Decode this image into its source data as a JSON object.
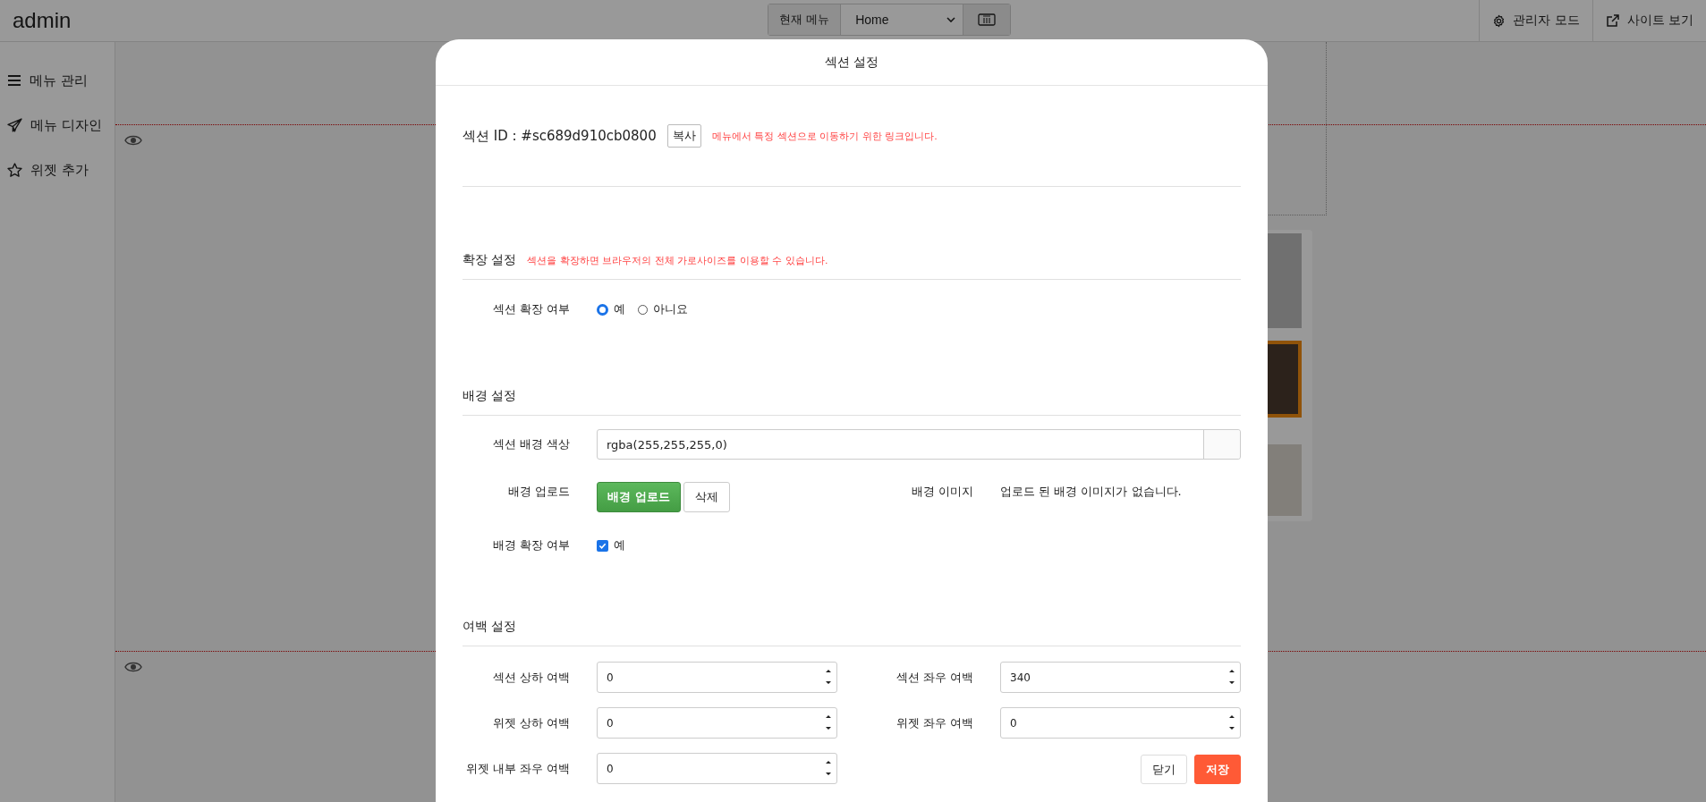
{
  "app": {
    "logo": "admin"
  },
  "toolbar": {
    "current_menu_label": "현재 메뉴",
    "current_menu_value": "Home"
  },
  "top_actions": [
    {
      "label": "관리자 모드",
      "kind": "gear"
    },
    {
      "label": "사이트 보기",
      "kind": "external"
    }
  ],
  "sidebar": {
    "items": [
      {
        "label": "메뉴 관리",
        "kind": "menu"
      },
      {
        "label": "메뉴 디자인",
        "kind": "plane"
      },
      {
        "label": "위젯 추가",
        "kind": "star"
      }
    ]
  },
  "modal": {
    "title": "섹션 설정",
    "section_id": {
      "label": "섹션 ID : #sc689d910cb0800",
      "copy_button": "복사",
      "note": "메뉴에서 특정 섹션으로 이동하기 위한 링크입니다."
    },
    "expand": {
      "heading": "확장 설정",
      "note": "섹션을 확장하면 브라우저의 전체 가로사이즈를 이용할 수 있습니다.",
      "field_label": "섹션 확장 여부",
      "options": [
        {
          "label": "예",
          "selected": true
        },
        {
          "label": "아니요",
          "selected": false
        }
      ]
    },
    "background": {
      "heading": "배경 설정",
      "color_label": "섹션 배경 색상",
      "color_value": "rgba(255,255,255,0)",
      "upload_label": "배경 업로드",
      "upload_button": "배경 업로드",
      "delete_button": "삭제",
      "image_label": "배경 이미지",
      "image_status": "업로드 된 배경 이미지가 없습니다.",
      "extend_label": "배경 확장 여부",
      "extend_option": {
        "label": "예",
        "checked": true
      }
    },
    "spacing": {
      "heading": "여백 설정",
      "fields": [
        {
          "label": "섹션 상하 여백",
          "value": "0"
        },
        {
          "label": "섹션 좌우 여백",
          "value": "340"
        },
        {
          "label": "위젯 상하 여백",
          "value": "0"
        },
        {
          "label": "위젯 좌우 여백",
          "value": "0"
        },
        {
          "label": "위젯 내부 좌우 여백",
          "value": "0"
        }
      ]
    },
    "buttons": [
      {
        "label": "닫기",
        "kind": "secondary"
      },
      {
        "label": "저장",
        "kind": "primary"
      }
    ]
  }
}
